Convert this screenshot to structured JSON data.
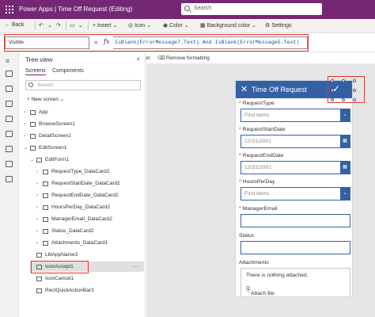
{
  "titlebar": {
    "app_title": "Power Apps  |  Time Off Request (Editing)",
    "search_placeholder": "Search",
    "color": "#742774"
  },
  "commandbar": {
    "back": "Back",
    "undo_icon": "undo-icon",
    "insert": "Insert",
    "icon": "Icon",
    "color": "Color",
    "background_color": "Background color",
    "settings": "Settings"
  },
  "formulabar": {
    "property": "Visible",
    "equals": "=",
    "fx": "fx",
    "formula": "IsBlank(ErrorMessage7.Text) And IsBlank(ErrorMessage5.Text)"
  },
  "formatbar": {
    "format_text": "Format text",
    "remove_formatting": "Remove formatting"
  },
  "tree": {
    "header": "Tree view",
    "tabs": [
      "Screens",
      "Components"
    ],
    "search_placeholder": "Search",
    "new_screen": "New screen",
    "nodes": [
      "App",
      "BrowseScreen1",
      "DetailScreen1",
      "EditScreen1",
      "EditForm1",
      "RequestType_DataCard2",
      "RequestStartDate_DataCard2",
      "RequestEndDate_DataCard2",
      "HoursPerDay_DataCard2",
      "ManagerEmail_DataCard2",
      "Status_DataCard2",
      "Attachments_DataCard1",
      "LblAppName3",
      "IconAccept1",
      "IconCancel1",
      "RectQuickActionBar3"
    ],
    "more": "···"
  },
  "form": {
    "title": "Time Off Request",
    "header_color": "#3461a5",
    "fields": {
      "request_type": {
        "label": "RequestType",
        "value": "Find items"
      },
      "start_date": {
        "label": "RequestStartDate",
        "value": "12/31/2001"
      },
      "end_date": {
        "label": "RequestEndDate",
        "value": "12/31/2001"
      },
      "hours_per_day": {
        "label": "HoursPerDay",
        "value": "Find items"
      },
      "manager_email": {
        "label": "ManagerEmail",
        "value": ""
      },
      "status": {
        "label": "Status",
        "value": ""
      },
      "attachments": {
        "label": "Attachments",
        "empty_text": "There is nothing attached.",
        "attach_file": "Attach file"
      }
    },
    "required_mark": "*"
  }
}
